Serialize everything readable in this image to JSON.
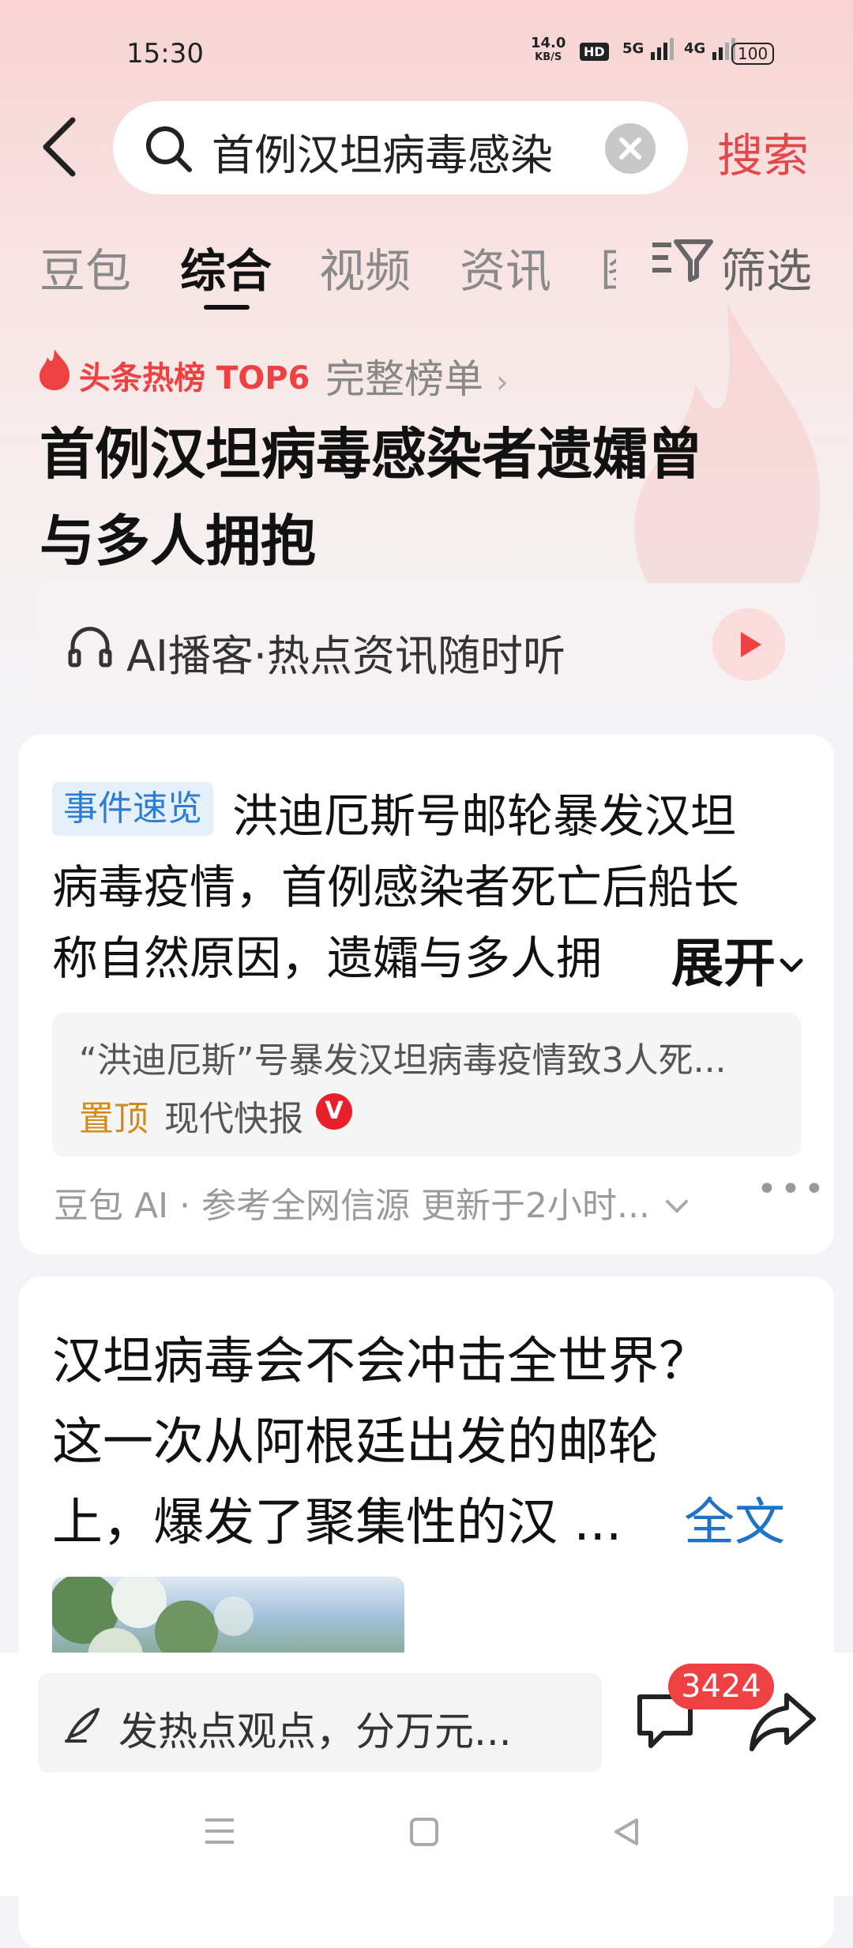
{
  "status_bar": {
    "time": "15:30",
    "net_speed": "14.0",
    "net_unit": "KB/S",
    "hd": "HD",
    "net1": "5G",
    "net2": "4G",
    "battery": "100"
  },
  "search": {
    "query": "首例汉坦病毒感染",
    "button": "搜索"
  },
  "tabs": [
    {
      "label": "豆包",
      "active": false
    },
    {
      "label": "综合",
      "active": true
    },
    {
      "label": "视频",
      "active": false
    },
    {
      "label": "资讯",
      "active": false
    },
    {
      "label": "图",
      "active": false
    }
  ],
  "filter_label": "筛选",
  "hot": {
    "rank": "头条热榜 TOP6",
    "list_link": "完整榜单",
    "headline_line1": "首例汉坦病毒感染者遗孀曾",
    "headline_line2": "与多人拥抱"
  },
  "podcast": {
    "text": "AI播客·热点资讯随时听"
  },
  "event_card": {
    "badge": "事件速览",
    "summary_line1": "洪迪厄斯号邮轮暴发汉坦",
    "summary_line2": "病毒疫情，首例感染者死亡后船长",
    "summary_line3": "称自然原因，遗孀与多人拥",
    "expand": "展开",
    "source_title": "“洪迪厄斯”号暴发汉坦病毒疫情致3人死...",
    "pinned": "置顶",
    "source_name": "现代快报",
    "verified": "V",
    "meta": "豆包 AI · 参考全网信源 更新于2小时..."
  },
  "post_card": {
    "line1": "汉坦病毒会不会冲击全世界？",
    "line2": "这一次从阿根廷出发的邮轮",
    "line3": "上，爆发了聚集性的汉 ...",
    "fulltext": "全文"
  },
  "bottom": {
    "comment_placeholder": "发热点观点，分万元...",
    "comment_count": "3424"
  },
  "colors": {
    "accent": "#e2474a",
    "link": "#1e73c8",
    "badge_blue": "#2b7cd3"
  }
}
